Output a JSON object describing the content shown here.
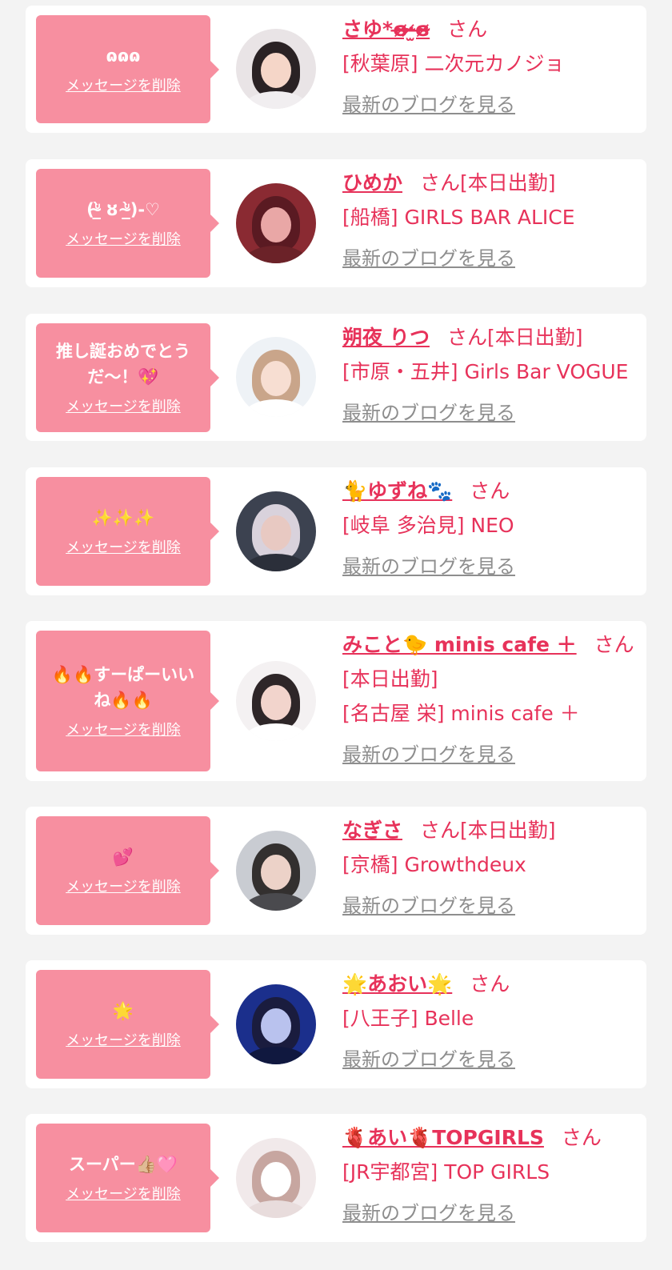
{
  "delete_label": "メッセージを削除",
  "blog_label": "最新のブログを見る",
  "san_label": "さん",
  "colors": {
    "accent": "#e7325a",
    "bubble": "#f78fa0",
    "link_gray": "#8e8e8e"
  },
  "cards": [
    {
      "message": "ɷɷɷ",
      "name": "さゆ*ɞ̴̶̷·̴̶̷̫ɞ̴̶̷",
      "tag": "",
      "shop": "[秋葉原] 二次元カノジョ"
    },
    {
      "message": "(ᐡ̴̲̀ ȣ ᐡ̴̲̀)-♡",
      "name": "ひめか",
      "tag": "[本日出勤]",
      "shop": "[船橋] GIRLS BAR ALICE"
    },
    {
      "message": "推し誕おめでとうだ〜！💖",
      "name": "朔夜 りつ",
      "tag": "[本日出勤]",
      "shop": "[市原・五井] Girls Bar VOGUE"
    },
    {
      "message": "✨✨✨",
      "name": "🐈ゆずね🐾",
      "tag": "",
      "shop": "[岐阜 多治見] NEO"
    },
    {
      "message": "🔥🔥すーぱーいいね🔥🔥",
      "name": "みこと🐤 minis cafe ＋",
      "tag": "",
      "extra": "[本日出勤]",
      "shop": "[名古屋 栄] minis cafe ＋"
    },
    {
      "message": "💕",
      "name": "なぎさ",
      "tag": "[本日出勤]",
      "shop": "[京橋] Growthdeux"
    },
    {
      "message": "🌟",
      "name": "🌟あおい🌟",
      "tag": "",
      "shop": "[八王子] Belle"
    },
    {
      "message": "スーパー👍🏼🩷",
      "name": "🫀あい🫀TOPGIRLS",
      "tag": "",
      "shop": "[JR宇都宮] TOP GIRLS"
    }
  ]
}
